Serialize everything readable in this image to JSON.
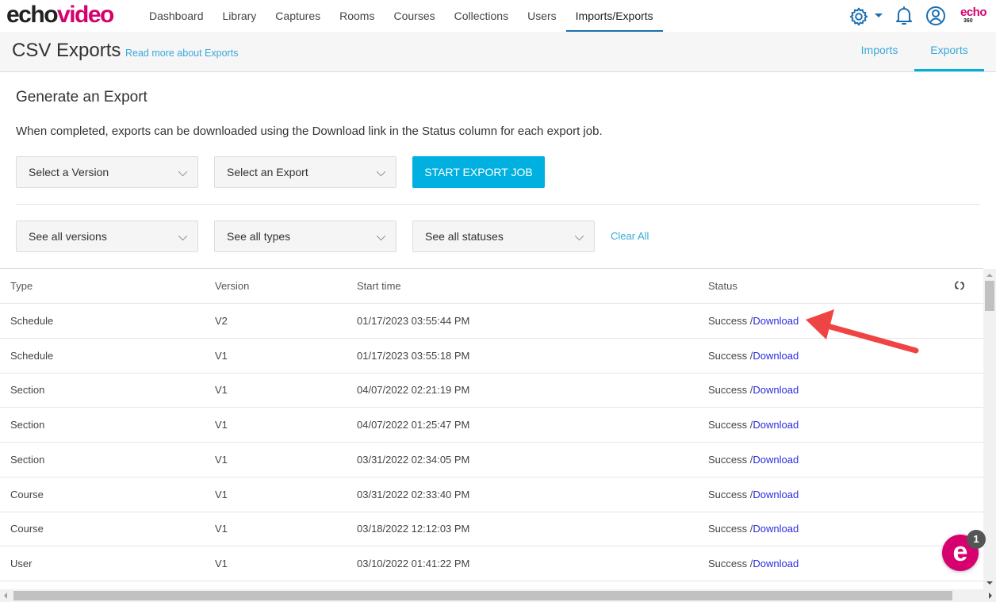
{
  "app": {
    "logo_part1": "echo",
    "logo_part2": "video",
    "brand_mini": "echo",
    "brand_mini_sub": "360"
  },
  "nav": {
    "items": [
      {
        "label": "Dashboard",
        "active": false
      },
      {
        "label": "Library",
        "active": false
      },
      {
        "label": "Captures",
        "active": false
      },
      {
        "label": "Rooms",
        "active": false
      },
      {
        "label": "Courses",
        "active": false
      },
      {
        "label": "Collections",
        "active": false
      },
      {
        "label": "Users",
        "active": false
      },
      {
        "label": "Imports/Exports",
        "active": true
      }
    ],
    "icons": [
      "gear-icon",
      "caret-down-icon",
      "bell-icon",
      "user-circle-icon"
    ]
  },
  "page_header": {
    "title": "CSV Exports",
    "read_more": "Read more about Exports",
    "tabs": [
      {
        "label": "Imports",
        "active": false
      },
      {
        "label": "Exports",
        "active": true
      }
    ]
  },
  "generate": {
    "title": "Generate an Export",
    "description": "When completed, exports can be downloaded using the Download link in the Status column for each export job.",
    "version_select": "Select a Version",
    "export_select": "Select an Export",
    "start_button": "START EXPORT JOB"
  },
  "filters": {
    "versions": "See all versions",
    "types": "See all types",
    "statuses": "See all statuses",
    "clear_all": "Clear All"
  },
  "table": {
    "headers": {
      "type": "Type",
      "version": "Version",
      "start_time": "Start time",
      "status": "Status"
    },
    "rows": [
      {
        "type": "Schedule",
        "version": "V2",
        "start_time": "01/17/2023 03:55:44 PM",
        "status": "Success /",
        "link": "Download"
      },
      {
        "type": "Schedule",
        "version": "V1",
        "start_time": "01/17/2023 03:55:18 PM",
        "status": "Success /",
        "link": "Download"
      },
      {
        "type": "Section",
        "version": "V1",
        "start_time": "04/07/2022 02:21:19 PM",
        "status": "Success /",
        "link": "Download"
      },
      {
        "type": "Section",
        "version": "V1",
        "start_time": "04/07/2022 01:25:47 PM",
        "status": "Success /",
        "link": "Download"
      },
      {
        "type": "Section",
        "version": "V1",
        "start_time": "03/31/2022 02:34:05 PM",
        "status": "Success /",
        "link": "Download"
      },
      {
        "type": "Course",
        "version": "V1",
        "start_time": "03/31/2022 02:33:40 PM",
        "status": "Success /",
        "link": "Download"
      },
      {
        "type": "Course",
        "version": "V1",
        "start_time": "03/18/2022 12:12:03 PM",
        "status": "Success /",
        "link": "Download"
      },
      {
        "type": "User",
        "version": "V1",
        "start_time": "03/10/2022 01:41:22 PM",
        "status": "Success /",
        "link": "Download"
      }
    ]
  },
  "chat": {
    "letter": "e",
    "badge_count": "1"
  },
  "colors": {
    "brand_pink": "#d6006f",
    "accent_blue": "#00b0e0",
    "link_blue": "#39a8dc",
    "download_link": "#2a2ae0",
    "annotation_arrow": "#ef4444"
  }
}
